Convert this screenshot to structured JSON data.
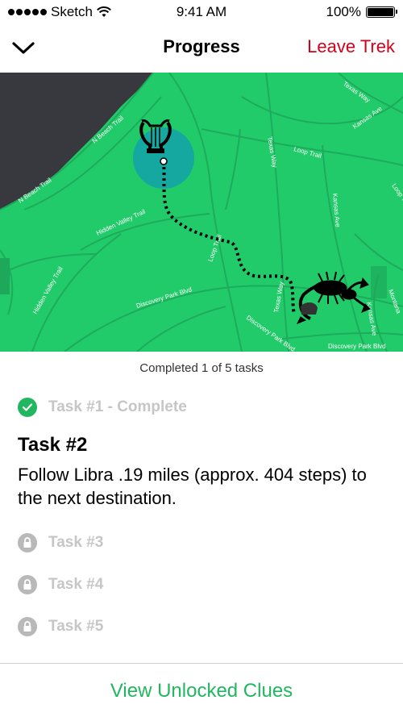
{
  "status_bar": {
    "carrier": "Sketch",
    "time": "9:41 AM",
    "battery": "100%"
  },
  "nav": {
    "title": "Progress",
    "leave": "Leave Trek",
    "back_icon": "chevron-down-icon"
  },
  "map": {
    "streets": [
      "N Beach Trail",
      "Texas Way",
      "Kansas Ave",
      "Texas Way",
      "Loop Trail",
      "Kansas Ave",
      "Loop Trail",
      "N Beach Trail",
      "Hidden Valley Trail",
      "Hidden Valley Trail",
      "Loop Trail",
      "Discovery Park Blvd",
      "Texas Way",
      "Discovery Park Blvd",
      "Discovery Park Blvd",
      "Kansas Ave",
      "Montana"
    ],
    "start_icon": "lyre-icon",
    "end_icon": "scorpion-icon"
  },
  "progress": {
    "text": "Completed 1 of 5 tasks"
  },
  "tasks": {
    "done": "Task #1 - Complete",
    "current_title": "Task #2",
    "current_desc": "Follow Libra .19 miles (approx. 404 steps) to the next destination.",
    "locked": [
      "Task #3",
      "Task #4",
      "Task #5"
    ]
  },
  "footer": {
    "button": "View Unlocked Clues"
  },
  "colors": {
    "accent": "#21b760",
    "danger": "#d0021b",
    "map_green": "#21cb69",
    "water": "#37393f"
  }
}
